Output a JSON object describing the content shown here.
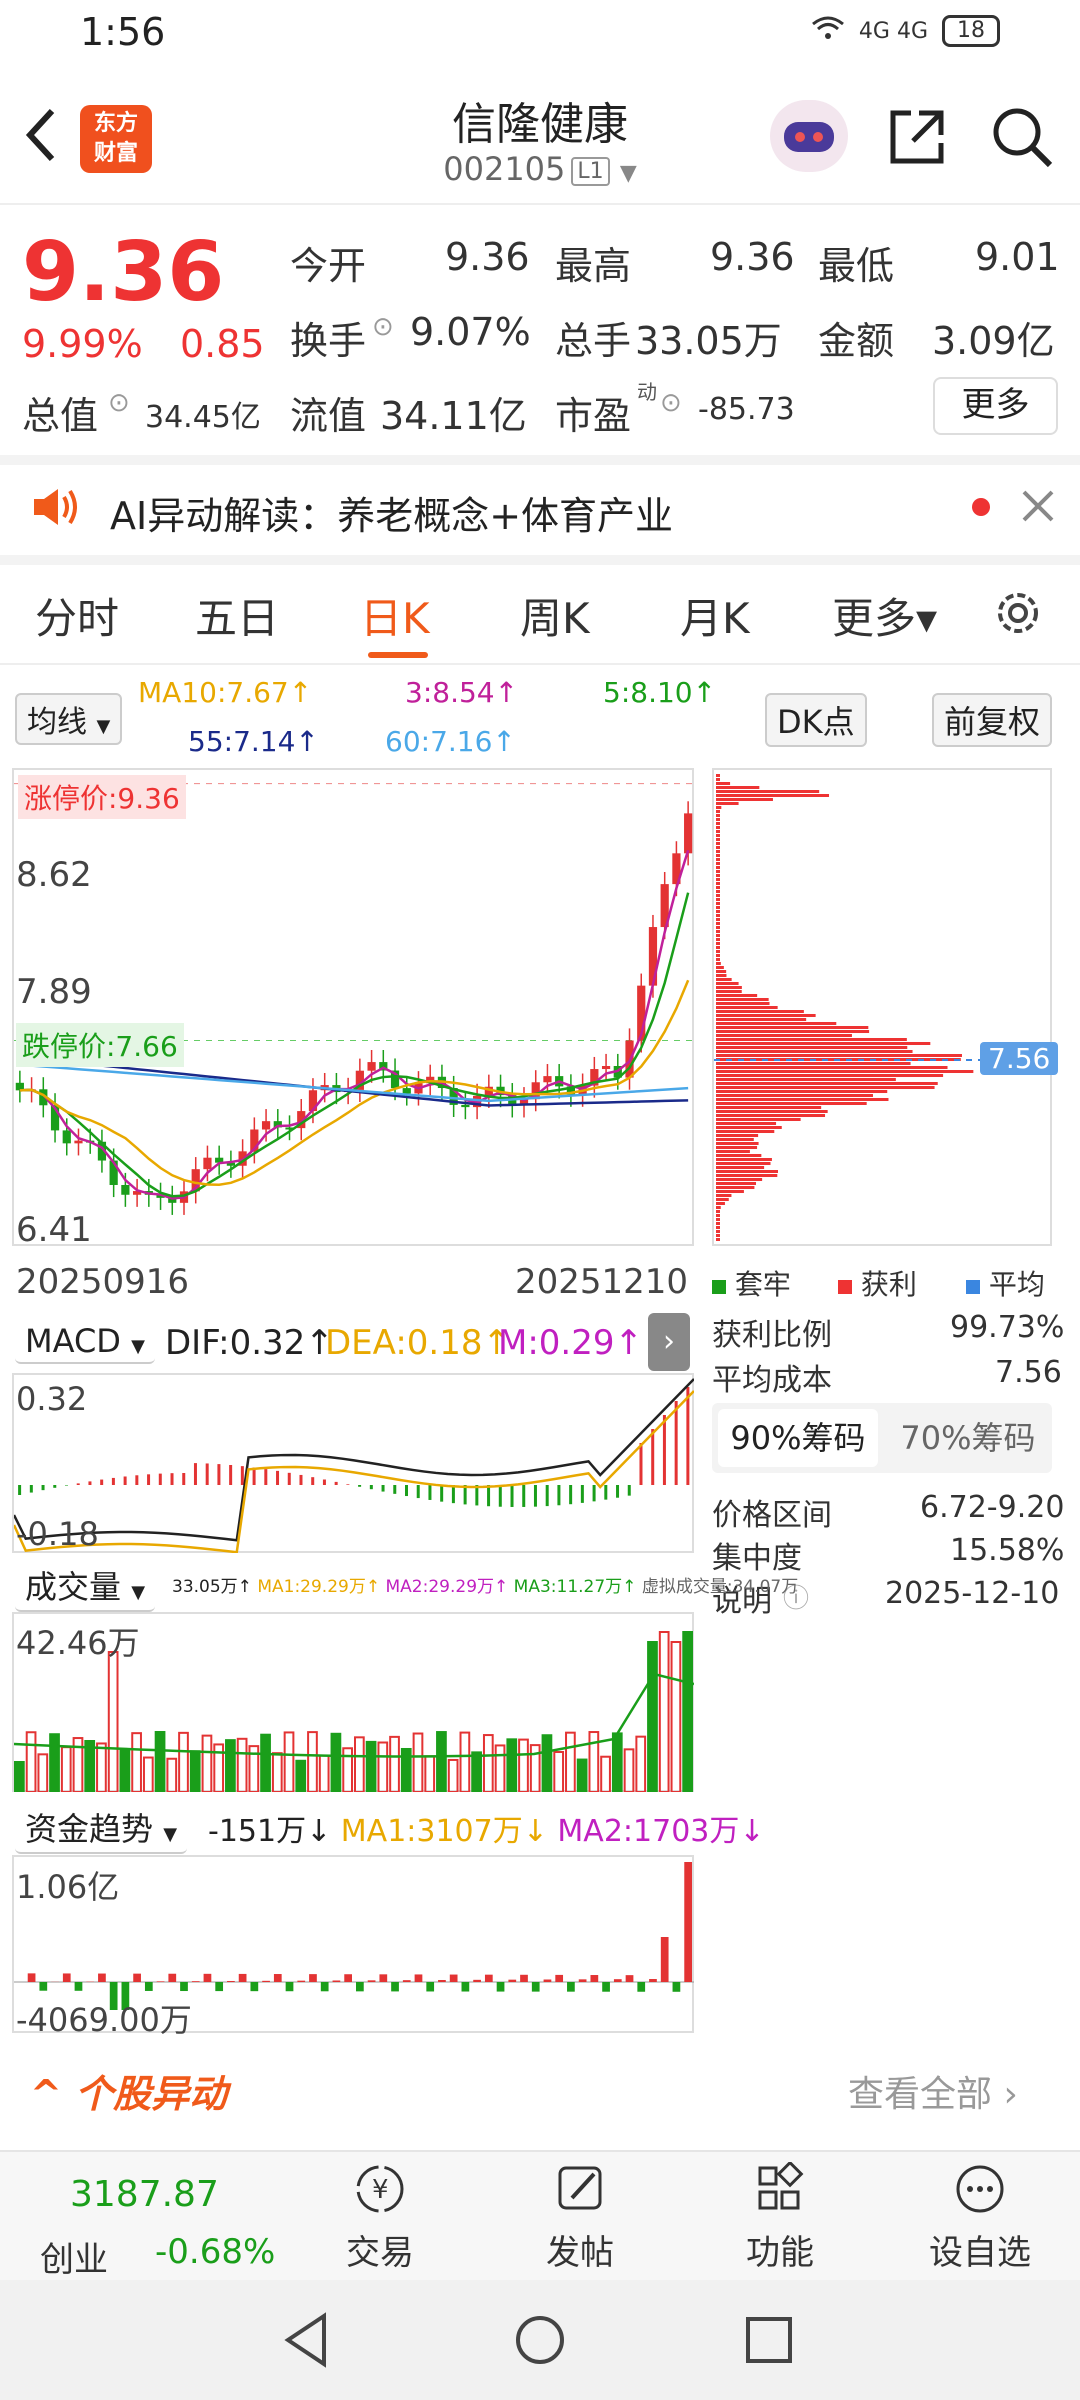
{
  "status_bar": {
    "time": "1:56",
    "signal": "4G 4G",
    "battery": "18"
  },
  "header": {
    "logo_line1": "东方",
    "logo_line2": "财富",
    "title": "信隆健康",
    "code": "002105",
    "level": "L1"
  },
  "quote": {
    "price": "9.36",
    "change_pct": "9.99%",
    "change": "0.85",
    "open_label": "今开",
    "open": "9.36",
    "high_label": "最高",
    "high": "9.36",
    "low_label": "最低",
    "low": "9.01",
    "turnover_label": "换手",
    "turnover": "9.07%",
    "volume_label": "总手",
    "volume": "33.05万",
    "amount_label": "金额",
    "amount": "3.09亿",
    "mktcap_label": "总值",
    "mktcap": "34.45亿",
    "float_label": "流值",
    "float": "34.11亿",
    "pe_label": "市盈",
    "pe_sup": "动",
    "pe": "-85.73",
    "more_btn": "更多"
  },
  "ai_banner": {
    "label": "AI异动解读：养老概念+体育产业"
  },
  "tabs": [
    "分时",
    "五日",
    "日K",
    "周K",
    "月K",
    "更多▾"
  ],
  "ma": {
    "selector": "均线",
    "ma10": "MA10:7.67↑",
    "ma3": "3:8.54↑",
    "ma5": "5:8.10↑",
    "ma55": "55:7.14↑",
    "ma60": "60:7.16↑",
    "dk_btn": "DK点",
    "adjust_btn": "前复权"
  },
  "kline": {
    "limit_up": "涨停价:9.36",
    "limit_down": "跌停价:7.66",
    "y_top": "8.62",
    "y_mid": "7.89",
    "y_bottom": "6.41",
    "y_ma": "7.",
    "date_start": "20250916",
    "date_end": "20251210",
    "cost_tag": "7.56"
  },
  "chip": {
    "legend": [
      "套牢",
      "获利",
      "平均"
    ],
    "profit_ratio_label": "获利比例",
    "profit_ratio": "99.73%",
    "avg_cost_label": "平均成本",
    "avg_cost": "7.56",
    "tab90": "90%筹码",
    "tab70": "70%筹码",
    "range_label": "价格区间",
    "range": "6.72-9.20",
    "concentration_label": "集中度",
    "concentration": "15.58%",
    "note_label": "说明",
    "note": "2025-12-10"
  },
  "macd": {
    "selector": "MACD",
    "dif": "DIF:0.32↑",
    "dea": "DEA:0.18↑",
    "m": "M:0.29↑",
    "y_top": "0.32",
    "y_bottom": "-0.18"
  },
  "volume": {
    "selector": "成交量",
    "v": "33.05万↑",
    "ma1": "MA1:29.29万↑",
    "ma2": "MA2:29.29万↑",
    "ma3": "MA3:11.27万↑",
    "virtual": "虚拟成交量:34.07万",
    "y_top": "42.46万"
  },
  "fund": {
    "selector": "资金趋势",
    "v": "-151万↓",
    "ma1": "MA1:3107万↓",
    "ma2": "MA2:1703万↓",
    "y_top": "1.06亿",
    "y_bottom": "-4069.00万"
  },
  "section": {
    "title": "个股异动",
    "view_all": "查看全部"
  },
  "bottom_nav": {
    "index_value": "3187.87",
    "index_name": "创业",
    "index_change": "-0.68%",
    "items": [
      "交易",
      "发帖",
      "功能",
      "设自选"
    ]
  },
  "colors": {
    "up": "#e33333",
    "down": "#1a9e1a",
    "accent": "#f05a1a"
  }
}
